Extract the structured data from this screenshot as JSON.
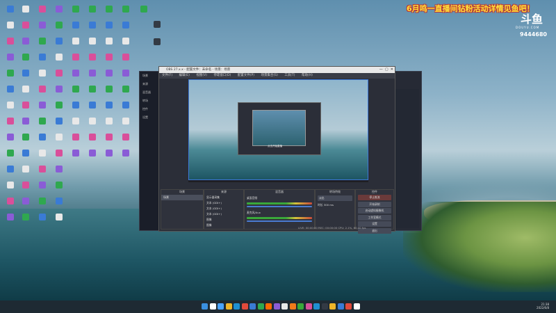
{
  "overlay": {
    "title": "6月鸣一直播间钻粉活动详情见鱼吧！",
    "logo_text": "斗鱼",
    "logo_sub": "DOUYU.COM",
    "room_id": "9444680"
  },
  "obs": {
    "title": "OBS 27.x.x - 配置文件：未命名 - 场景：场景",
    "menu": [
      "文件(F)",
      "编辑(E)",
      "视图(V)",
      "停靠窗口(D)",
      "配置文件(P)",
      "场景集合(S)",
      "工具(T)",
      "帮助(H)"
    ],
    "nested_label": "点击开始直播",
    "docks": {
      "scenes": "场景",
      "sources": "来源",
      "mixer": "混音器",
      "transitions": "转场特效",
      "controls": "控件"
    },
    "scenes": [
      "场景"
    ],
    "sources": [
      "显示器采集",
      "文本 (GDI+)",
      "文本 (GDI+)",
      "文本 (GDI+)",
      "图像",
      "图像"
    ],
    "mixer_channels": [
      "桌面音频",
      "麦克风/Aux"
    ],
    "transition": {
      "type": "淡出",
      "duration_label": "时长",
      "duration_value": "300 ms"
    },
    "controls": [
      "停止推流",
      "开始录制",
      "启动虚拟摄像机",
      "工作室模式",
      "设置",
      "退出"
    ],
    "status": "LIVE: 00:00:00   REC: 00:00:00   CPU: 2.1%, 60.00 fps"
  },
  "left_panel": [
    "场景",
    "来源",
    "混音器",
    "转场",
    "控件",
    "设置"
  ],
  "taskbar": {
    "time": "21:38",
    "date": "2022/6/8"
  }
}
